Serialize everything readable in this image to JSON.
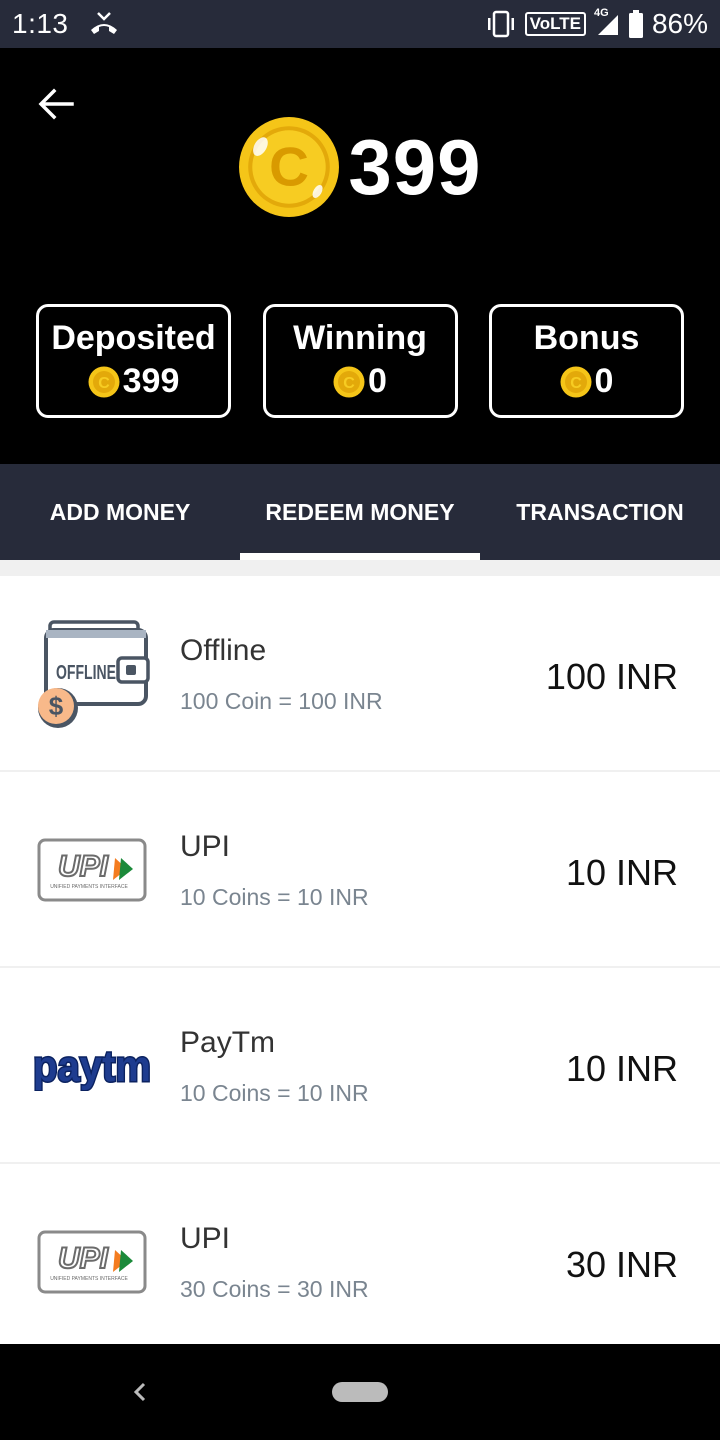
{
  "status_bar": {
    "time": "1:13",
    "call_icon": "missed-call-icon",
    "vibrate_icon": "vibrate-icon",
    "volte": "VoLTE",
    "network": "4G",
    "battery": "86%"
  },
  "header": {
    "back_icon": "arrow-left-icon",
    "balance": "399",
    "wallets": [
      {
        "label": "Deposited",
        "value": "399"
      },
      {
        "label": "Winning",
        "value": "0"
      },
      {
        "label": "Bonus",
        "value": "0"
      }
    ]
  },
  "tabs": [
    {
      "label": "ADD MONEY",
      "active": false
    },
    {
      "label": "REDEEM MONEY",
      "active": true
    },
    {
      "label": "TRANSACTION",
      "active": false
    }
  ],
  "redeem_options": [
    {
      "icon": "offline-wallet-icon",
      "title": "Offline",
      "rate": "100 Coin = 100 INR",
      "amount": "100 INR"
    },
    {
      "icon": "upi-logo-icon",
      "title": "UPI",
      "rate": "10 Coins = 10 INR",
      "amount": "10 INR"
    },
    {
      "icon": "paytm-logo-icon",
      "title": "PayTm",
      "rate": "10 Coins = 10 INR",
      "amount": "10 INR"
    },
    {
      "icon": "upi-logo-icon",
      "title": "UPI",
      "rate": "30 Coins = 30 INR",
      "amount": "30 INR"
    }
  ],
  "logo_text": {
    "offline": "OFFLINE",
    "upi": "UPI",
    "upi_sub": "UNIFIED PAYMENTS INTERFACE",
    "paytm": "paytm"
  },
  "colors": {
    "header_bg": "#000000",
    "tab_bg": "#272b3a",
    "coin": "#f5c518",
    "paytm_blue": "#1e3c8f"
  }
}
